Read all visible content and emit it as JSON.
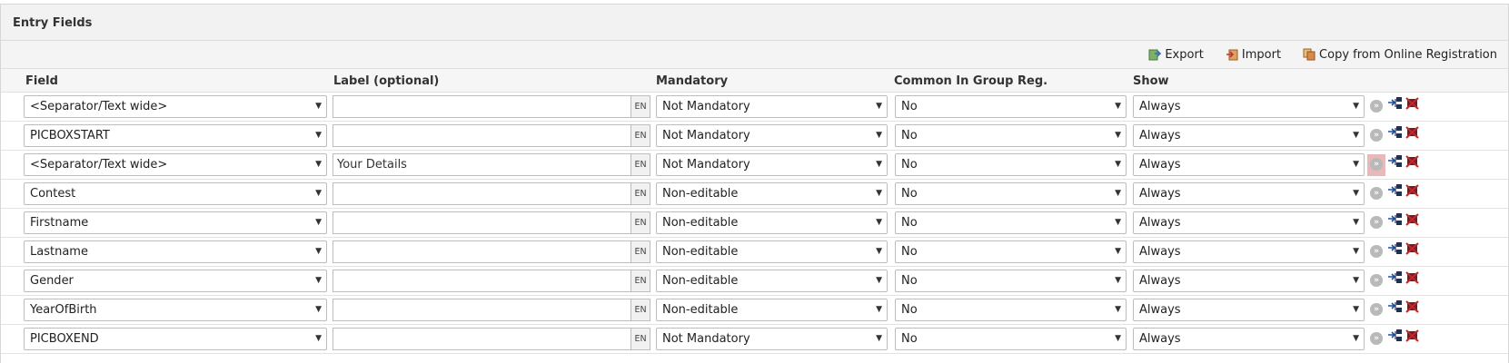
{
  "panel": {
    "title": "Entry Fields"
  },
  "toolbar": {
    "buttons": [
      {
        "label": "Export",
        "icon": "export-icon"
      },
      {
        "label": "Import",
        "icon": "import-icon"
      },
      {
        "label": "Copy from Online Registration",
        "icon": "copy-icon"
      }
    ]
  },
  "columns": {
    "field": "Field",
    "label": "Label (optional)",
    "mandatory": "Mandatory",
    "common": "Common In Group Reg.",
    "show": "Show"
  },
  "lang_code": "EN",
  "rows": [
    {
      "field": "<Separator/Text wide>",
      "label": "",
      "mandatory": "Not Mandatory",
      "common": "No",
      "show": "Always"
    },
    {
      "field": "PICBOXSTART",
      "label": "",
      "mandatory": "Not Mandatory",
      "common": "No",
      "show": "Always"
    },
    {
      "field": "<Separator/Text wide>",
      "label": "Your Details",
      "mandatory": "Not Mandatory",
      "common": "No",
      "show": "Always",
      "highlighted": true
    },
    {
      "field": "Contest",
      "label": "",
      "mandatory": "Non-editable",
      "common": "No",
      "show": "Always"
    },
    {
      "field": "Firstname",
      "label": "",
      "mandatory": "Non-editable",
      "common": "No",
      "show": "Always"
    },
    {
      "field": "Lastname",
      "label": "",
      "mandatory": "Non-editable",
      "common": "No",
      "show": "Always"
    },
    {
      "field": "Gender",
      "label": "",
      "mandatory": "Non-editable",
      "common": "No",
      "show": "Always"
    },
    {
      "field": "YearOfBirth",
      "label": "",
      "mandatory": "Non-editable",
      "common": "No",
      "show": "Always"
    },
    {
      "field": "PICBOXEND",
      "label": "",
      "mandatory": "Not Mandatory",
      "common": "No",
      "show": "Always"
    }
  ],
  "colors": {
    "delete_red": "#c0282d",
    "tree_blue": "#1f4f9a",
    "highlight": "#e9b8b8"
  }
}
